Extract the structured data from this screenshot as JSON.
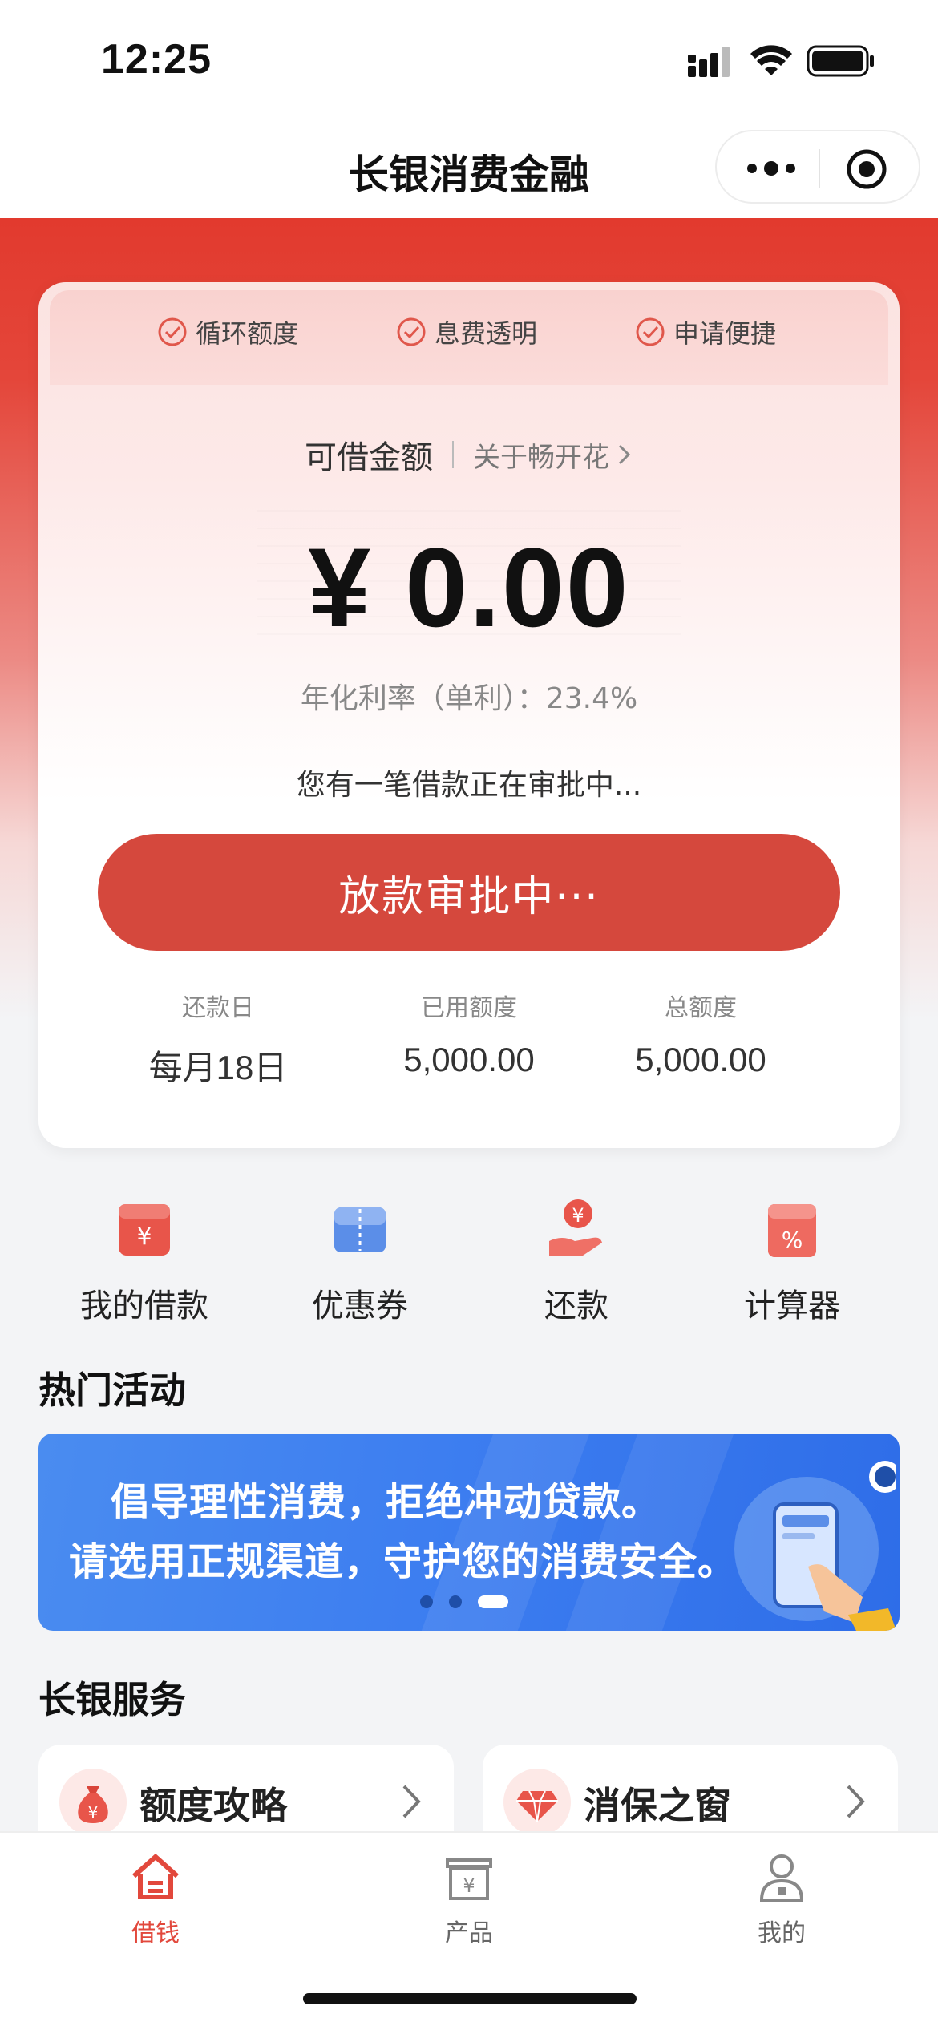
{
  "status_bar": {
    "time": "12:25"
  },
  "nav": {
    "title": "长银消费金融"
  },
  "card": {
    "features": [
      "循环额度",
      "息费透明",
      "申请便捷"
    ],
    "available_label": "可借金额",
    "about_link": "关于畅开花",
    "amount": "¥ 0.00",
    "rate_text": "年化利率（单利）：23.4%",
    "pending_text": "您有一笔借款正在审批中...",
    "main_button": "放款审批中···",
    "stats": [
      {
        "label": "还款日",
        "value": "每月18日"
      },
      {
        "label": "已用额度",
        "value": "5,000.00"
      },
      {
        "label": "总额度",
        "value": "5,000.00"
      }
    ]
  },
  "quick_entries": [
    {
      "label": "我的借款",
      "icon": "loan-icon"
    },
    {
      "label": "优惠券",
      "icon": "coupon-icon"
    },
    {
      "label": "还款",
      "icon": "repay-icon"
    },
    {
      "label": "计算器",
      "icon": "calculator-icon"
    }
  ],
  "hot_activities": {
    "title": "热门活动",
    "banner_line1": "倡导理性消费，拒绝冲动贷款。",
    "banner_line2": "请选用正规渠道，守护您的消费安全。",
    "active_slide": 3,
    "total_slides": 3
  },
  "services": {
    "title": "长银服务",
    "items": [
      {
        "label": "额度攻略",
        "icon": "money-bag-icon"
      },
      {
        "label": "消保之窗",
        "icon": "diamond-icon"
      }
    ]
  },
  "tabbar": {
    "items": [
      {
        "label": "借钱",
        "icon": "home-icon",
        "active": true
      },
      {
        "label": "产品",
        "icon": "product-icon",
        "active": false
      },
      {
        "label": "我的",
        "icon": "profile-icon",
        "active": false
      }
    ]
  },
  "colors": {
    "brand_red": "#e23a2e",
    "button_red": "#d5483d",
    "banner_blue": "#3d7ef0",
    "tab_active": "#e2483c"
  }
}
